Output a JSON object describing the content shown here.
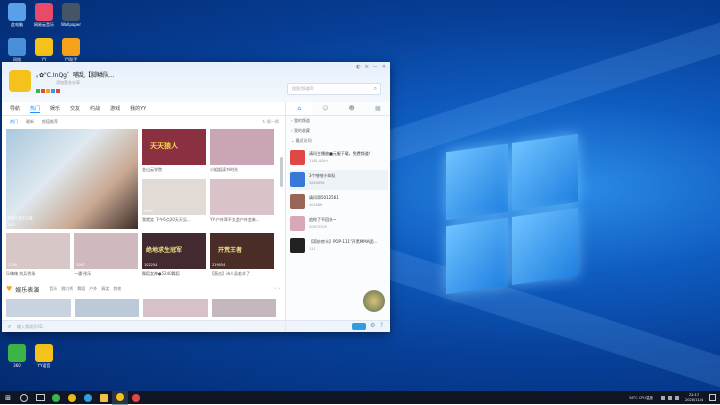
{
  "desktop": {
    "icons": [
      {
        "name": "此电脑",
        "color": "#5aa0e8"
      },
      {
        "name": "网易云音乐",
        "color": "#e84a6a"
      },
      {
        "name": "Wallpaper",
        "color": "#445566"
      },
      {
        "name": "网络",
        "color": "#4a90d9"
      },
      {
        "name": "YY",
        "color": "#f4c21a"
      },
      {
        "name": "YY助手",
        "color": "#f4a31a"
      },
      {
        "name": "360",
        "color": "#3bb548"
      },
      {
        "name": "YY语音",
        "color": "#f4c21a"
      }
    ]
  },
  "window": {
    "username": "｡✿\"C.InQg゛哺乱【脚鳞队...",
    "signature": "添加签名分享",
    "search_placeholder": "搜索/频道ID",
    "tabs": [
      {
        "label": "导航",
        "active": false
      },
      {
        "label": "热门",
        "active": true
      },
      {
        "label": "娱乐",
        "active": false
      },
      {
        "label": "交友",
        "active": false
      },
      {
        "label": "约战",
        "active": false
      },
      {
        "label": "游戏",
        "active": false
      },
      {
        "label": "我的YY",
        "active": false
      }
    ],
    "subtabs": [
      {
        "label": "热门",
        "active": true
      },
      {
        "label": "最新",
        "active": false
      },
      {
        "label": "颜值推荐",
        "active": false
      }
    ],
    "refresh_label": "换一换",
    "hero": {
      "caption": "网易云音乐主播",
      "viewers": "229"
    },
    "tiles": [
      {
        "caption": "金山云学院",
        "views": "",
        "color": "#8a3040",
        "overlay": "天天狼人"
      },
      {
        "caption": "小姐姐读书时光",
        "views": "",
        "color": "#c9a5b5"
      },
      {
        "caption": "我就笑 下午6点20天天见...",
        "views": "5663",
        "color": "#e2dad5"
      },
      {
        "caption": "YY-户外哥不太会户外会来...",
        "views": "",
        "color": "#d9c2c8"
      },
      {
        "caption": "乐嗨嗨 刘兵秀场",
        "views": "1794",
        "color": "#d7c7c7"
      },
      {
        "caption": "一遇·彤乐",
        "views": "3067",
        "color": "#cfb9bc"
      },
      {
        "caption": "舞蹈女神●5240舞蹈",
        "views": "102254",
        "color": "#422a30",
        "overlay": "绝地求生冠军"
      },
      {
        "caption": "【直击】诗人吴若羊了",
        "views": "219054",
        "color": "#4b2d28",
        "overlay": "开荒王者"
      }
    ],
    "section_title": "娱乐表演",
    "section_tags": [
      "音乐",
      "脱口秀",
      "舞蹈",
      "户外",
      "搞笑",
      "其他"
    ],
    "bottom_search": "输入频道号/ID",
    "right_panel": {
      "lines": [
        "我的频道",
        "我的收藏",
        "最近访问"
      ],
      "rows": [
        {
          "title": "请问主播放■元服下载，免费频道!",
          "sub": "1161,00k+",
          "color": "#e04848"
        },
        {
          "title": "3个哈哈小伙队",
          "sub": "2864698",
          "color": "#3a78d8"
        },
        {
          "title": "请问哥5012561",
          "sub": "401686",
          "color": "#996655"
        },
        {
          "title": "追你了不回头~",
          "sub": "20673209",
          "color": "#d8a8b8"
        },
        {
          "title": "【奇妙房卡】POP-111\"开黑MMA团...",
          "sub": "111",
          "color": "#222222"
        }
      ]
    }
  },
  "taskbar": {
    "clock_time": "22:17",
    "clock_date": "2020/11/4",
    "cpu_label": "58°C CPU温度",
    "items": [
      {
        "name": "start",
        "color": "#ffffff"
      },
      {
        "name": "search",
        "color": "#cccccc"
      },
      {
        "name": "task-view",
        "color": "#cccccc"
      },
      {
        "name": "360",
        "color": "#3bb548"
      },
      {
        "name": "chrome",
        "color": "#e9b91c"
      },
      {
        "name": "edge",
        "color": "#2f9de0"
      },
      {
        "name": "folder",
        "color": "#f2c14c"
      },
      {
        "name": "yy",
        "color": "#f4c21a"
      },
      {
        "name": "media",
        "color": "#e04848"
      }
    ]
  }
}
